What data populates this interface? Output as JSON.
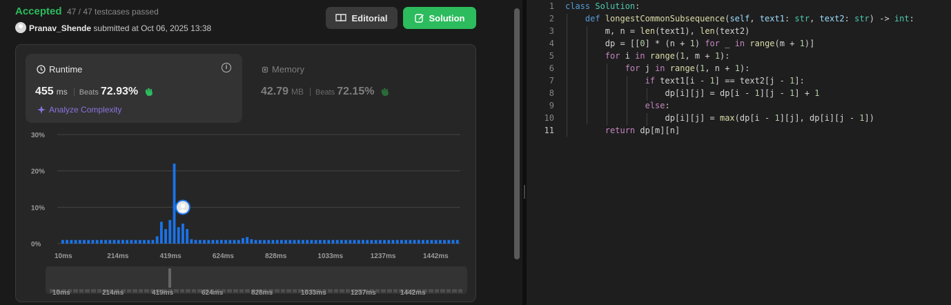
{
  "submission": {
    "status": "Accepted",
    "testcases": "47 / 47 testcases passed",
    "username": "Pranav_Shende",
    "submitted_text": "submitted at Oct 06, 2025 13:38"
  },
  "buttons": {
    "editorial": "Editorial",
    "solution": "Solution"
  },
  "runtime": {
    "title": "Runtime",
    "value": "455",
    "unit": "ms",
    "beats_label": "Beats",
    "beats_value": "72.93%",
    "analyze": "Analyze Complexity"
  },
  "memory": {
    "title": "Memory",
    "value": "42.79",
    "unit": "MB",
    "beats_label": "Beats",
    "beats_value": "72.15%"
  },
  "colors": {
    "accepted": "#2cbb5d",
    "bar": "#1a73e8",
    "analyze": "#8b74e0"
  },
  "chart_data": {
    "type": "bar",
    "title": "",
    "xlabel": "",
    "ylabel": "",
    "y_tick_labels": [
      "30%",
      "20%",
      "10%",
      "0%"
    ],
    "ylim": [
      0,
      30
    ],
    "x_tick_labels": [
      "10ms",
      "214ms",
      "419ms",
      "624ms",
      "828ms",
      "1033ms",
      "1237ms",
      "1442ms"
    ],
    "highlight_index": 28,
    "values": [
      1,
      1,
      1,
      1,
      1,
      1,
      1,
      1,
      1,
      1,
      1,
      1,
      1,
      1,
      1,
      1,
      1,
      1,
      1,
      1,
      1,
      1,
      2,
      6,
      4,
      6.5,
      22,
      4.5,
      5.5,
      4,
      1.2,
      1,
      1,
      1,
      1,
      1,
      1,
      1,
      1,
      1,
      1,
      1,
      1.5,
      1.8,
      1.2,
      1,
      1,
      1,
      1,
      1,
      1,
      1,
      1,
      1,
      1,
      1,
      1,
      1,
      1,
      1,
      1,
      1,
      1,
      1,
      1,
      1,
      1,
      1,
      1,
      1,
      1,
      1,
      1,
      1,
      1,
      1,
      1,
      1,
      1,
      1,
      1,
      1,
      1,
      1,
      1,
      1,
      1,
      1,
      1,
      1,
      1,
      1,
      1
    ]
  },
  "scroller": {
    "tick_labels": [
      "10ms",
      "214ms",
      "419ms",
      "624ms",
      "828ms",
      "1033ms",
      "1237ms",
      "1442ms"
    ]
  },
  "editor": {
    "line_numbers": [
      "1",
      "2",
      "3",
      "4",
      "5",
      "6",
      "7",
      "8",
      "9",
      "10",
      "11"
    ],
    "active_line": 11
  }
}
